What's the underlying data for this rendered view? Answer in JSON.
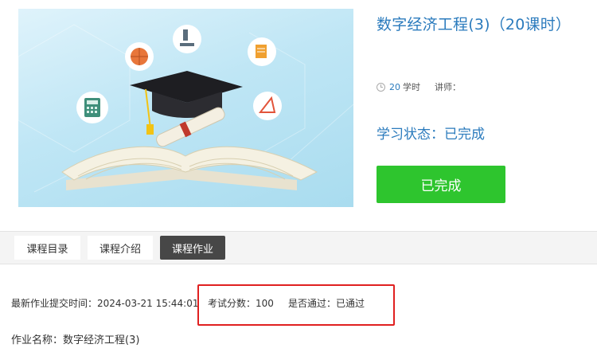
{
  "course": {
    "title": "数字经济工程(3)（20课时）",
    "hours_value": "20",
    "hours_unit": "学时",
    "lecturer_label": "讲师：",
    "status_text": "学习状态：已完成",
    "complete_button": "已完成"
  },
  "tabs": [
    {
      "label": "课程目录",
      "active": false
    },
    {
      "label": "课程介绍",
      "active": false
    },
    {
      "label": "课程作业",
      "active": true
    }
  ],
  "assignment": {
    "submit_time_label": "最新作业提交时间：",
    "submit_time": "2024-03-21 15:44:01",
    "score_label": "考试分数：",
    "score": "100",
    "passed_label": "是否通过：",
    "passed": "已通过",
    "name_label": "作业名称：",
    "name": "数字经济工程(3)"
  },
  "colors": {
    "title_blue": "#2b7bbd",
    "complete_green": "#2ec52e",
    "active_tab": "#474747",
    "highlight_red": "#e02020"
  }
}
